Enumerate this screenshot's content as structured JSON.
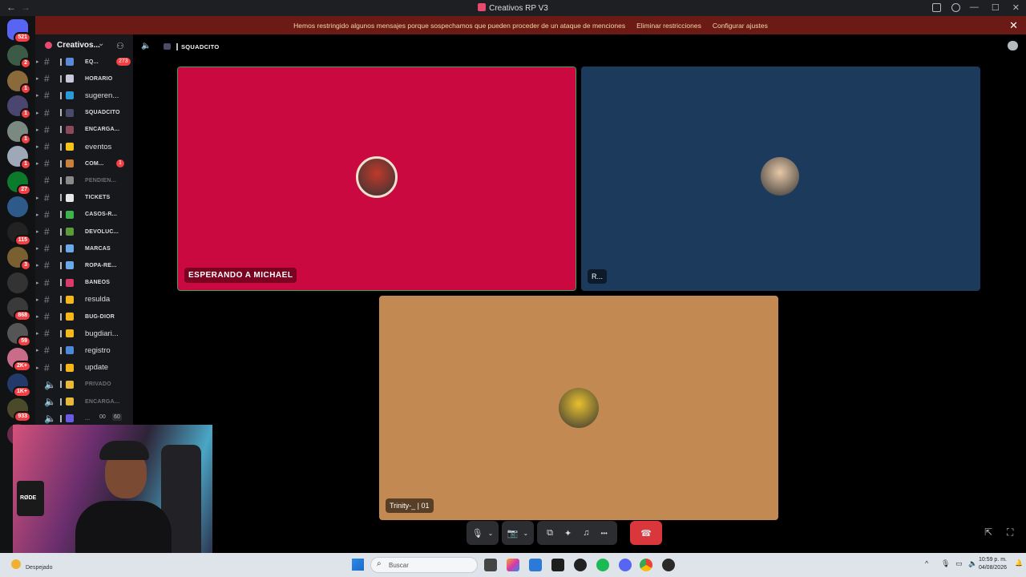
{
  "titlebar": {
    "title": "Creativos RP V3",
    "back": "←",
    "forward": "→"
  },
  "banner": {
    "message": "Hemos restringido algunos mensajes porque sospechamos que pueden proceder de un ataque de menciones",
    "action1": "Eliminar restricciones",
    "action2": "Configurar ajustes",
    "close": "✕"
  },
  "servers": {
    "home_badge": "521",
    "items": [
      {
        "badge": "2",
        "color": "#3b5b47"
      },
      {
        "badge": "1",
        "color": "#8a6a3a"
      },
      {
        "badge": "1",
        "color": "#4b4670"
      },
      {
        "badge": "1",
        "color": "#7a8a80"
      },
      {
        "badge": "1",
        "color": "#9fa8b8"
      },
      {
        "badge": "27",
        "color": "#0b7a2b"
      },
      {
        "badge": "",
        "color": "#2e5a8a"
      },
      {
        "badge": "115",
        "color": "#222"
      },
      {
        "badge": "3",
        "color": "#7a6030"
      },
      {
        "badge": "",
        "color": "#333"
      },
      {
        "badge": "868",
        "color": "#3a3a3a"
      },
      {
        "badge": "59",
        "color": "#555"
      },
      {
        "badge": "2K+",
        "color": "#c86c8a"
      },
      {
        "badge": "1K+",
        "color": "#223a6a"
      },
      {
        "badge": "933",
        "color": "#4a4a2a"
      },
      {
        "badge": "2",
        "color": "#6a2a4a"
      }
    ]
  },
  "guild": {
    "name": "Creativos...",
    "chevron": "⌄"
  },
  "channels": [
    {
      "name": "EQ...",
      "style": "small",
      "badge": "273",
      "emoji_color": "#5b8ad8",
      "muted": false
    },
    {
      "name": "HORARIO",
      "style": "small",
      "badge": "",
      "emoji_color": "#c8c8d8",
      "muted": false
    },
    {
      "name": "sugeren...",
      "style": "big",
      "badge": "",
      "emoji_color": "#2b9ad8",
      "muted": false
    },
    {
      "name": "SQUADCITO",
      "style": "small",
      "badge": "",
      "emoji_color": "#4a4a6a",
      "muted": false
    },
    {
      "name": "ENCARGA...",
      "style": "small",
      "badge": "",
      "emoji_color": "#8a4a5a",
      "muted": false
    },
    {
      "name": "eventos",
      "style": "big",
      "badge": "",
      "emoji_color": "#f5c518",
      "muted": false
    },
    {
      "name": "COM...",
      "style": "small",
      "badge": "1",
      "emoji_color": "#c8803a",
      "muted": false
    },
    {
      "name": "PENDIEN...",
      "style": "small",
      "badge": "",
      "emoji_color": "#8a8a8a",
      "muted": true
    },
    {
      "name": "TICKETS",
      "style": "small",
      "badge": "",
      "emoji_color": "#e8e8e8",
      "muted": false
    },
    {
      "name": "CASOS-R...",
      "style": "small",
      "badge": "",
      "emoji_color": "#3bb54a",
      "muted": false
    },
    {
      "name": "DEVOLUC...",
      "style": "small",
      "badge": "",
      "emoji_color": "#5a9a3a",
      "muted": false
    },
    {
      "name": "MARCAS",
      "style": "small",
      "badge": "",
      "emoji_color": "#6aaae8",
      "muted": false
    },
    {
      "name": "ROPA-RE...",
      "style": "small",
      "badge": "",
      "emoji_color": "#6aaae8",
      "muted": false
    },
    {
      "name": "BANEOS",
      "style": "small",
      "badge": "",
      "emoji_color": "#d83a6a",
      "muted": false
    },
    {
      "name": "resulda",
      "style": "big",
      "badge": "",
      "emoji_color": "#f5b818",
      "muted": false
    },
    {
      "name": "BUG-DIOR",
      "style": "small",
      "badge": "",
      "emoji_color": "#f5b818",
      "muted": false
    },
    {
      "name": "bugdiari...",
      "style": "big",
      "badge": "",
      "emoji_color": "#f5b818",
      "muted": false
    },
    {
      "name": "registro",
      "style": "big",
      "badge": "",
      "emoji_color": "#4a8ad8",
      "muted": false
    },
    {
      "name": "update",
      "style": "big",
      "badge": "",
      "emoji_color": "#f5b818",
      "muted": false
    },
    {
      "name": "PRIVADO",
      "style": "small",
      "badge": "",
      "emoji_color": "#e8b83a",
      "muted": true
    },
    {
      "name": "ENCARGA...",
      "style": "small",
      "badge": "",
      "emoji_color": "#e8b83a",
      "muted": true
    },
    {
      "name": "...",
      "style": "small",
      "badge": "",
      "emoji_color": "#6a5ae8",
      "muted": true
    }
  ],
  "voice_counter": {
    "left": "00",
    "right": "60"
  },
  "call": {
    "channel_name": "SQUADCITO",
    "tiles": [
      {
        "label": "ESPERANDO A MICHAEL",
        "color": "#c9093f",
        "avatar_color": "#c0392b"
      },
      {
        "label": "R...",
        "color": "#1b3a5c",
        "avatar_color": "#e8c8a8"
      },
      {
        "label": "Trinity-_ | 01",
        "color": "#c28a52",
        "avatar_color": "#e8c030"
      }
    ]
  },
  "controls": {
    "mic": "🎙",
    "camera": "📷",
    "share": "⧉",
    "activities": "✦",
    "soundboard": "♫",
    "more": "•••",
    "hangup": "☎",
    "popout": "⇱",
    "fullscreen": "⛶"
  },
  "webcam": {
    "mic_brand": "RØDE"
  },
  "taskbar": {
    "weather": "Despejado",
    "search_placeholder": "Buscar",
    "time": "10:59 p. m.",
    "date": "04/08/2026"
  }
}
